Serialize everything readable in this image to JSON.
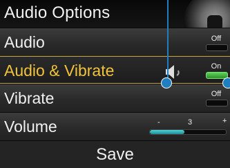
{
  "header": {
    "title": "Audio Options"
  },
  "rows": [
    {
      "label": "Audio",
      "toggle": "Off",
      "on": false
    },
    {
      "label": "Audio & Vibrate",
      "toggle": "On",
      "on": true
    },
    {
      "label": "Vibrate",
      "toggle": "Off",
      "on": false
    },
    {
      "label": "Volume",
      "slider": {
        "min_label": "-",
        "value": "3",
        "max_label": "+",
        "level": 0.45
      }
    }
  ],
  "footer": {
    "save_label": "Save"
  },
  "icons": [
    "knob-icon",
    "speaker-icon"
  ],
  "colors": {
    "selected_text": "#f1c33b",
    "selected_border": "#c9a83c",
    "toggle_on": "#4cc64a",
    "slider_fill": "#3ec3c9",
    "callout": "#1f7fc0"
  }
}
